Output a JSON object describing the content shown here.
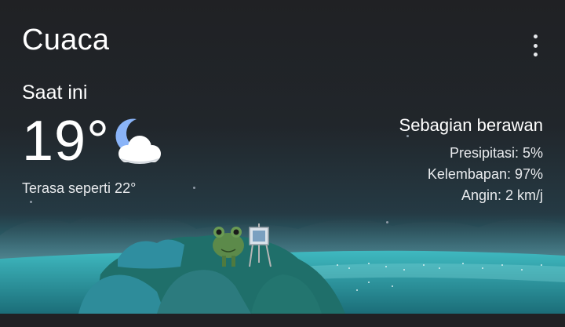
{
  "app": {
    "title": "Cuaca"
  },
  "icons": {
    "menu": "more-vert-icon",
    "condition": "partly-cloudy-night-icon"
  },
  "current": {
    "label": "Saat ini",
    "temperature": "19°",
    "feels_like": "Terasa seperti 22°",
    "condition": "Sebagian berawan",
    "precipitation": "Presipitasi: 5%",
    "humidity": "Kelembapan: 97%",
    "wind": "Angin: 2 km/j"
  },
  "colors": {
    "background": "#202124",
    "text": "#ffffff",
    "teal": "#2a8d95"
  }
}
